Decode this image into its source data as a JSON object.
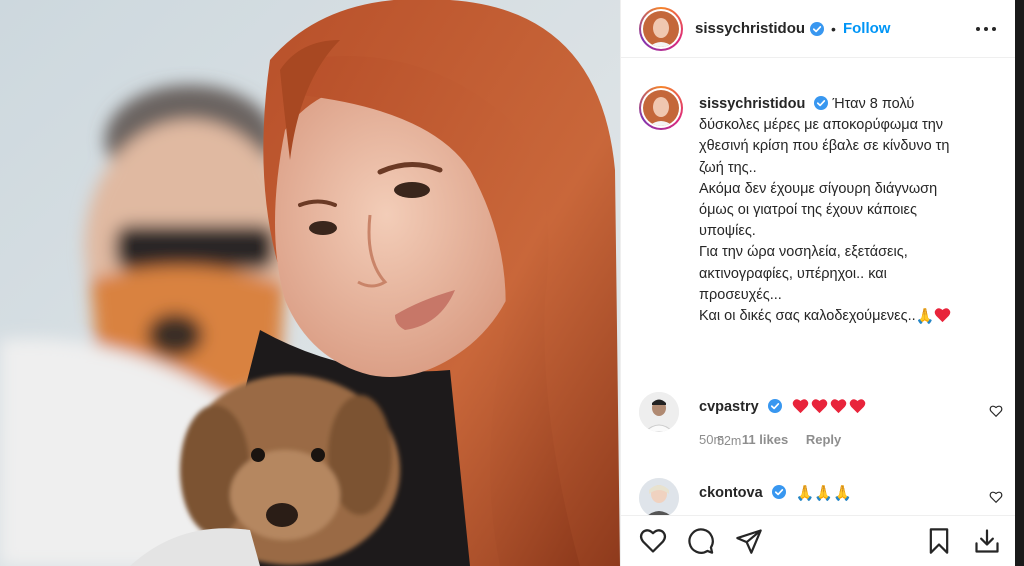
{
  "post": {
    "username": "sissychristidou",
    "follow_label": "Follow",
    "separator": "•"
  },
  "caption": {
    "username": "sissychristidou",
    "lines": [
      "Ήταν 8 πολύ",
      "δύσκολες μέρες με αποκορύφωμα την",
      "χθεσινή κρίση που έβαλε σε κίνδυνο τη",
      "ζωή της..",
      "Ακόμα δεν έχουμε σίγουρη διάγνωση",
      "όμως οι γιατροί της έχουν κάποιες",
      "υποψίες.",
      "Για την ώρα νοσηλεία, εξετάσεις,",
      "ακτινογραφίες, υπέρηχοι.. και",
      "προσευχές...",
      "Και οι δικές σας καλοδεχούμενες.."
    ],
    "emoji_tail": [
      "🙏",
      "❤"
    ],
    "time": "52m"
  },
  "comments": [
    {
      "username": "cvpastry",
      "body_emoji": [
        "❤",
        "❤",
        "❤",
        "❤"
      ],
      "time": "50m",
      "likes": "11 likes",
      "reply_label": "Reply"
    },
    {
      "username": "ckontova",
      "body_emoji": [
        "🙏",
        "🙏",
        "🙏"
      ]
    }
  ],
  "icons": {
    "verified": "verified-badge-icon",
    "more": "more-options-icon",
    "like": "heart-icon",
    "comment": "comment-bubble-icon",
    "share": "paper-plane-icon",
    "save": "bookmark-icon",
    "download": "download-icon"
  },
  "colors": {
    "link_blue": "#0095f6",
    "verified_blue": "#3897f0",
    "text": "#262626",
    "muted": "#8e8e8e",
    "heart_red": "#ed4956"
  }
}
